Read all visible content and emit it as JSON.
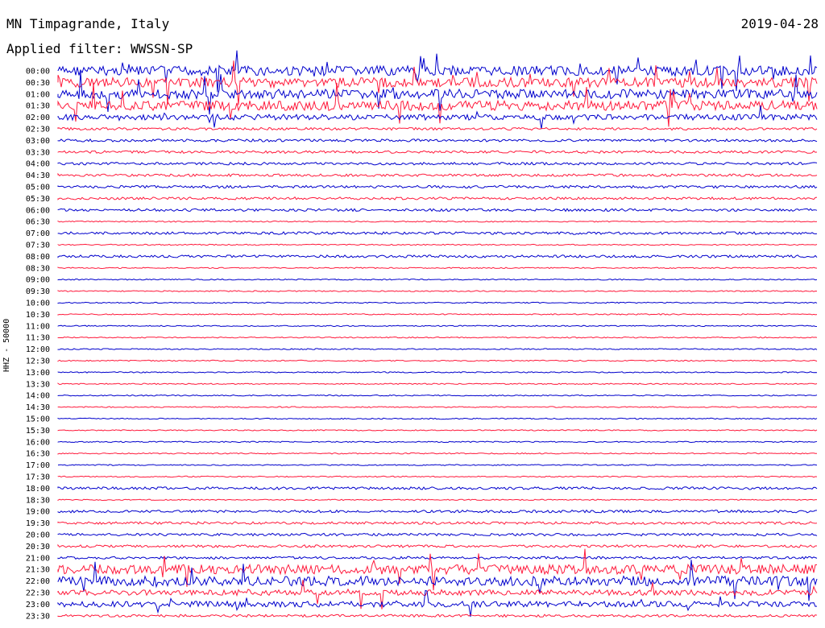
{
  "header": {
    "station": "MN Timpagrande, Italy",
    "date": "2019-04-28",
    "filter_label": "Applied filter:",
    "filter_value": "WWSSN-SP"
  },
  "chart_data": {
    "type": "line",
    "ylabel": "HHZ - 50000",
    "rows": [
      "00:00",
      "00:30",
      "01:00",
      "01:30",
      "02:00",
      "02:30",
      "03:00",
      "03:30",
      "04:00",
      "04:30",
      "05:00",
      "05:30",
      "06:00",
      "06:30",
      "07:00",
      "07:30",
      "08:00",
      "08:30",
      "09:00",
      "09:30",
      "10:00",
      "10:30",
      "11:00",
      "11:30",
      "12:00",
      "12:30",
      "13:00",
      "13:30",
      "14:00",
      "14:30",
      "15:00",
      "15:30",
      "16:00",
      "16:30",
      "17:00",
      "17:30",
      "18:00",
      "18:30",
      "19:00",
      "19:30",
      "20:00",
      "20:30",
      "21:00",
      "21:30",
      "22:00",
      "22:30",
      "23:00",
      "23:30"
    ],
    "colors": {
      "even": "#0000cc",
      "odd": "#ff1a3c"
    },
    "activity": [
      3,
      3,
      3,
      3,
      2,
      1,
      1,
      1,
      1,
      1,
      1,
      1,
      1,
      0,
      1,
      0,
      1,
      0,
      0,
      0,
      0,
      0,
      0,
      0,
      0,
      0,
      0,
      0,
      0,
      0,
      0,
      0,
      0,
      0,
      0,
      0,
      1,
      0,
      1,
      1,
      1,
      1,
      1,
      3,
      3,
      2,
      2,
      1
    ]
  }
}
